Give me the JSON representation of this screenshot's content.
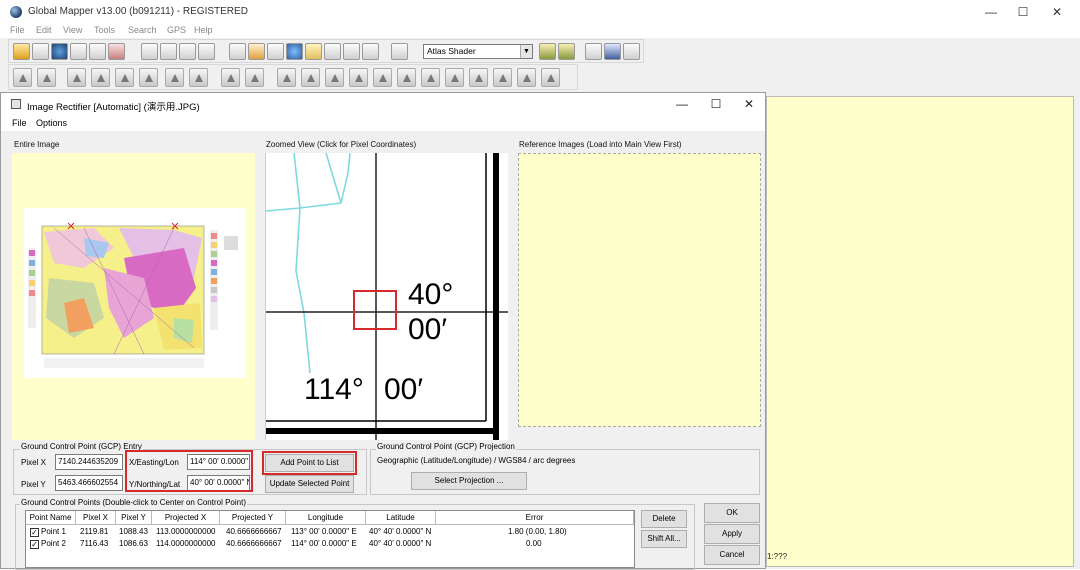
{
  "app": {
    "title": "Global Mapper v13.00 (b091211) - REGISTERED",
    "window_controls": {
      "minimize": "—",
      "maximize": "☐",
      "close": "✕"
    },
    "menu": [
      "File",
      "Edit",
      "View",
      "Tools",
      "Search",
      "GPS",
      "Help"
    ],
    "shader_select": "Atlas Shader",
    "scale_status": "1:???"
  },
  "dialog": {
    "title": "Image Rectifier [Automatic] (演示用.JPG)",
    "window_controls": {
      "minimize": "—",
      "maximize": "☐",
      "close": "✕"
    },
    "menu": [
      "File",
      "Options"
    ],
    "entire_image_label": "Entire Image",
    "zoomed_view_label": "Zoomed View (Click for Pixel Coordinates)",
    "reference_label": "Reference Images (Load into Main View First)",
    "zoom_text": {
      "lat_deg": "40°",
      "lat_min": "00′",
      "lon_deg": "114°",
      "lon_min": "00′"
    },
    "gcp_entry": {
      "legend": "Ground Control Point (GCP) Entry",
      "pixel_x_label": "Pixel X",
      "pixel_x_value": "7140.244635209",
      "pixel_y_label": "Pixel Y",
      "pixel_y_value": "5463.466602554",
      "x_label": "X/Easting/Lon",
      "x_value": "114° 00' 0.0000\"",
      "y_label": "Y/Northing/Lat",
      "y_value": "40° 00' 0.0000\" N",
      "add_button": "Add Point to List",
      "update_button": "Update Selected Point"
    },
    "gcp_projection": {
      "legend": "Ground Control Point (GCP) Projection",
      "text": "Geographic (Latitude/Longitude) / WGS84 / arc degrees",
      "select_button": "Select Projection ..."
    },
    "gcp_list": {
      "legend": "Ground Control Points (Double-click to Center on Control Point)",
      "columns": [
        "Point Name",
        "Pixel X",
        "Pixel Y",
        "Projected X",
        "Projected Y",
        "Longitude",
        "Latitude",
        "Error"
      ],
      "rows": [
        [
          "Point 1",
          "2119.81",
          "1088.43",
          "113.0000000000",
          "40.6666666667",
          "113° 00' 0.0000\" E",
          "40° 40' 0.0000\" N",
          "1.80 (0.00, 1.80)"
        ],
        [
          "Point 2",
          "7116.43",
          "1086.63",
          "114.0000000000",
          "40.6666666667",
          "114° 00' 0.0000\" E",
          "40° 40' 0.0000\" N",
          "0.00"
        ]
      ],
      "delete_button": "Delete",
      "shift_button": "Shift All..."
    },
    "ok_button": "OK",
    "apply_button": "Apply",
    "cancel_button": "Cancel"
  }
}
